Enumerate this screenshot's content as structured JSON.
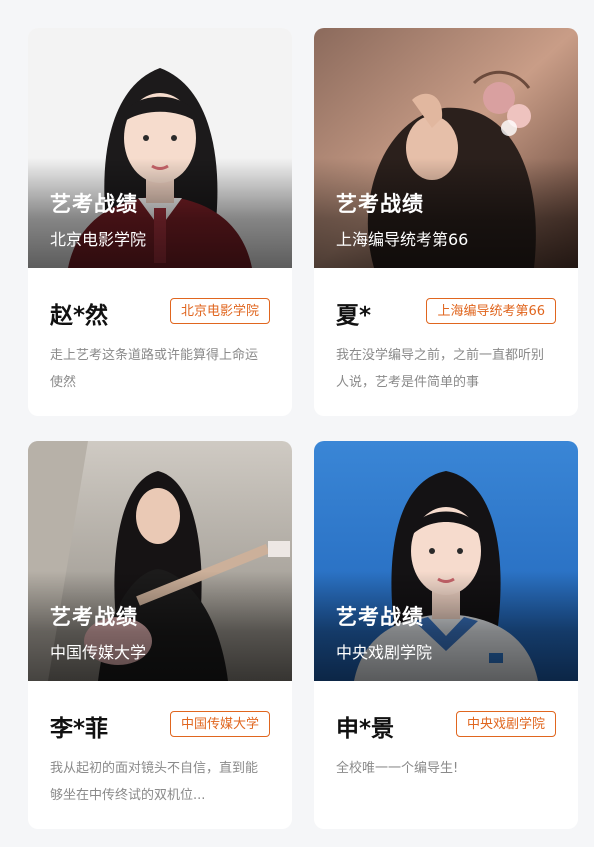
{
  "cards": [
    {
      "overlay_title": "艺考战绩",
      "overlay_school": "北京电影学院",
      "name": "赵*然",
      "tag": "北京电影学院",
      "description": "走上艺考这条道路或许能算得上命运使然"
    },
    {
      "overlay_title": "艺考战绩",
      "overlay_school": "上海编导统考第66",
      "name": "夏*",
      "tag": "上海编导统考第66",
      "description": "我在没学编导之前，之前一直都听别人说，艺考是件简单的事"
    },
    {
      "overlay_title": "艺考战绩",
      "overlay_school": "中国传媒大学",
      "name": "李*菲",
      "tag": "中国传媒大学",
      "description": "我从起初的面对镜头不自信，直到能够坐在中传终试的双机位..."
    },
    {
      "overlay_title": "艺考战绩",
      "overlay_school": "中央戏剧学院",
      "name": "申*景",
      "tag": "中央戏剧学院",
      "description": "全校唯一一个编导生!"
    }
  ],
  "colors": {
    "accent": "#e0661f",
    "page_bg": "#f5f6f8",
    "card_bg": "#ffffff",
    "desc_text": "#8a8a8a"
  }
}
